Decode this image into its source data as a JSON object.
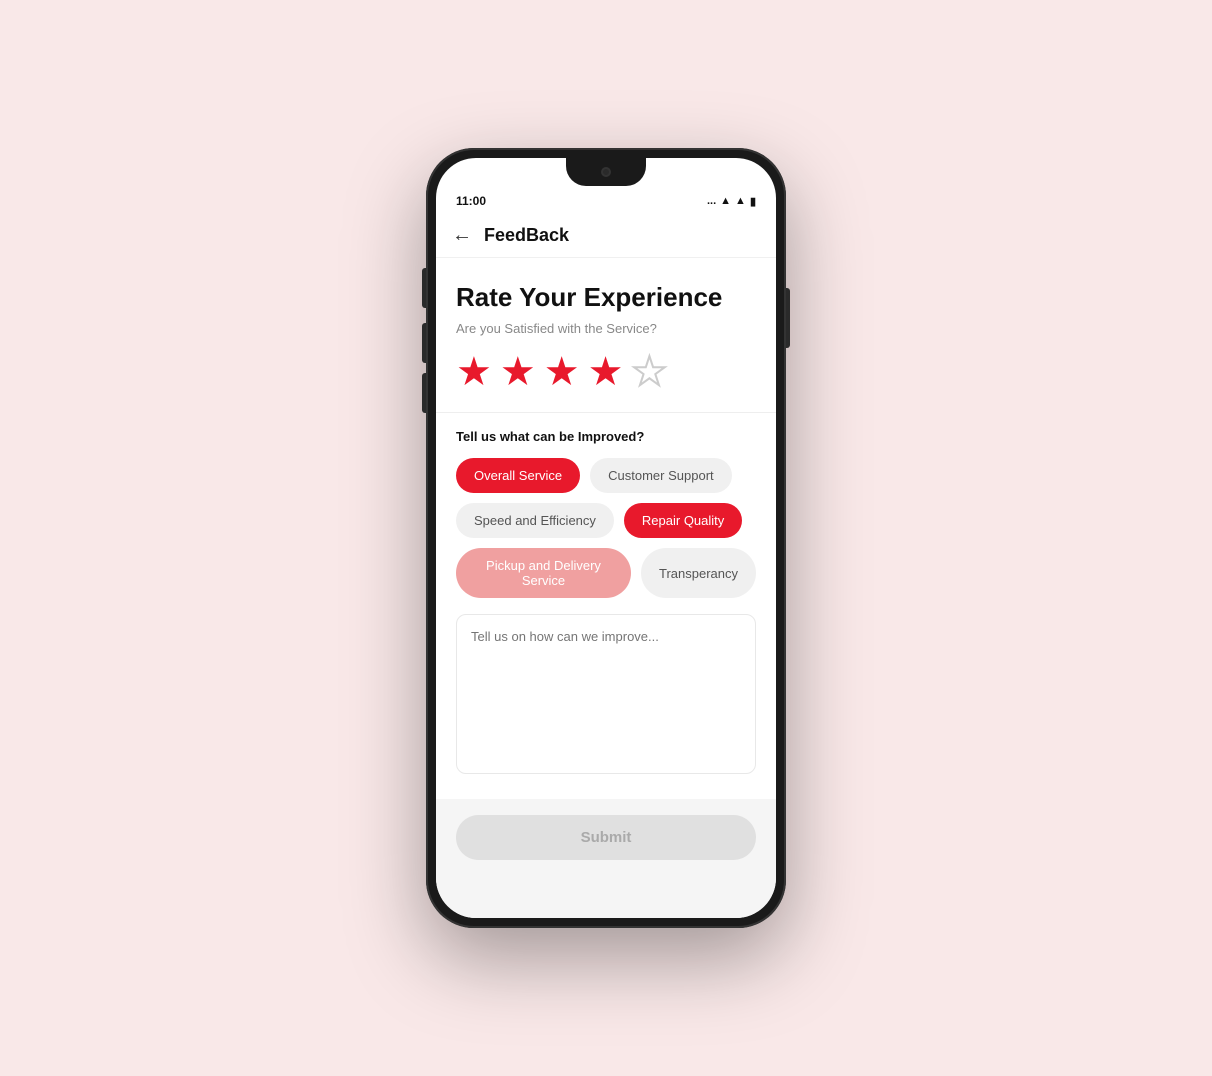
{
  "page": {
    "background_color": "#f9e8e8"
  },
  "status_bar": {
    "time": "11:00",
    "dots": "...",
    "wifi": "wifi",
    "signal": "signal",
    "battery": "battery"
  },
  "header": {
    "back_label": "←",
    "title": "FeedBack"
  },
  "rate_section": {
    "title": "Rate Your Experience",
    "subtitle": "Are you Satisfied with the Service?",
    "stars": [
      {
        "id": 1,
        "filled": true
      },
      {
        "id": 2,
        "filled": true
      },
      {
        "id": 3,
        "filled": true
      },
      {
        "id": 4,
        "filled": true
      },
      {
        "id": 5,
        "filled": false
      }
    ]
  },
  "improve_section": {
    "label": "Tell us what can be Improved?",
    "tags": [
      {
        "id": "overall-service",
        "label": "Overall Service",
        "state": "active-red"
      },
      {
        "id": "customer-support",
        "label": "Customer Support",
        "state": "inactive"
      },
      {
        "id": "speed-efficiency",
        "label": "Speed and Efficiency",
        "state": "inactive"
      },
      {
        "id": "repair-quality",
        "label": "Repair Quality",
        "state": "active-red"
      },
      {
        "id": "pickup-delivery",
        "label": "Pickup and Delivery Service",
        "state": "active-pink"
      },
      {
        "id": "transparency",
        "label": "Transperancy",
        "state": "inactive"
      }
    ]
  },
  "textarea": {
    "placeholder": "Tell us on how can we improve..."
  },
  "footer": {
    "submit_label": "Submit"
  }
}
